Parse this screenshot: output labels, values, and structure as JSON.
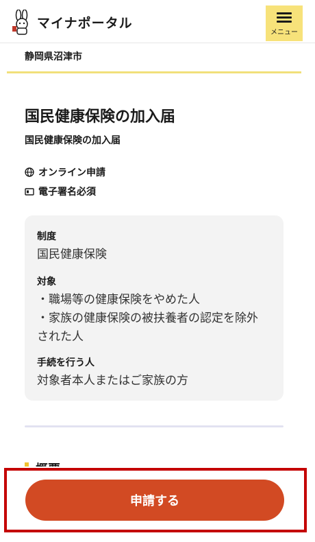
{
  "header": {
    "logo_text": "マイナポータル",
    "menu_label": "メニュー"
  },
  "city": "静岡県沼津市",
  "procedure": {
    "title": "国民健康保険の加入届",
    "subtitle": "国民健康保険の加入届",
    "tags": [
      "オンライン申請",
      "電子署名必須"
    ]
  },
  "card": {
    "system_label": "制度",
    "system_value": "国民健康保険",
    "target_label": "対象",
    "target_item_1": "・職場等の健康保険をやめた人",
    "target_item_2_line1": "・家族の健康保険の被扶養者の認定を除外",
    "target_item_2_line2": "された人",
    "actor_label": "手続を行う人",
    "actor_value": "対象者本人またはご家族の方"
  },
  "section_peek": "概要",
  "apply_button": "申請する"
}
